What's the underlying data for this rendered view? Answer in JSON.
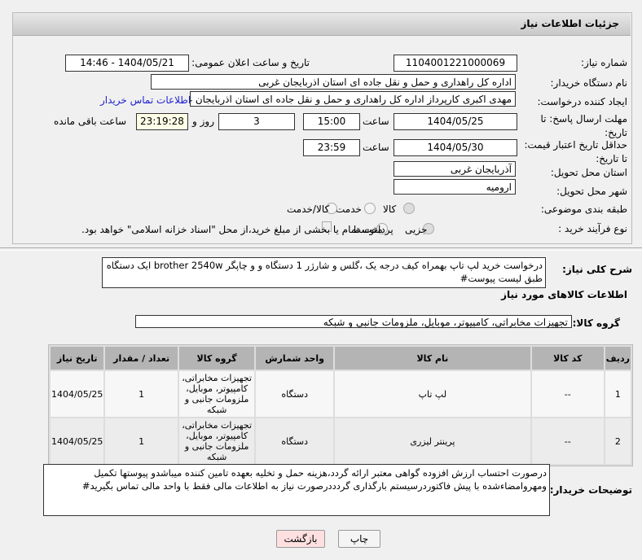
{
  "title": "جزئیات اطلاعات نیاز",
  "fields": {
    "need_number_label": "شماره نیاز:",
    "need_number": "1104001221000069",
    "announce_label": "تاریخ و ساعت اعلان عمومی:",
    "announce_value": "1404/05/21 - 14:46",
    "buyer_org_label": "نام دستگاه خریدار:",
    "buyer_org": "اداره کل راهداری و حمل و نقل جاده ای استان اذربایجان غربی",
    "creator_label": "ایجاد کننده درخواست:",
    "creator": "مهدی اکبری کارپرداز اداره کل راهداری و حمل و نقل جاده ای استان اذربایجان غر",
    "contact_link": "اطلاعات تماس خریدار",
    "deadline_label": "مهلت ارسال پاسخ: تا تاریخ:",
    "deadline_date": "1404/05/25",
    "time_label": "ساعت",
    "deadline_time": "15:00",
    "days": "3",
    "days_label": "روز و",
    "remaining": "23:19:28",
    "remaining_label": "ساعت باقی مانده",
    "validity_label": "حداقل تاریخ اعتبار قیمت: تا تاریخ:",
    "validity_date": "1404/05/30",
    "validity_time": "23:59",
    "province_label": "استان محل تحویل:",
    "province": "آذربایجان غربی",
    "city_label": "شهر محل تحویل:",
    "city": "ارومیه",
    "category_label": "طبقه بندی موضوعی:",
    "cat_options": [
      "کالا",
      "خدمت",
      "کالا/خدمت"
    ],
    "process_label": "نوع فرآیند خرید :",
    "process_options": [
      "جزیی",
      "متوسط"
    ],
    "payment_note": "پرداخت تمام یا بخشی از مبلغ خرید،از محل \"اسناد خزانه اسلامی\" خواهد بود."
  },
  "description_label": "شرح کلی نیاز:",
  "description": "درخواست خرید لپ تاپ  بهمراه کیف درجه یک ،گلس و شارژر 1 دستگاه و و چاپگر brother 2540w ایک دستگاه طبق لیست پیوست#",
  "goods_title": "اطلاعات کالاهای مورد نیاز",
  "group_label": "گروه کالا:",
  "group_value": "تجهیزات مخابراتی، کامپیوتر، موبایل، ملزومات جانبی و شبکه",
  "table": {
    "headers": [
      "ردیف",
      "کد کالا",
      "نام کالا",
      "واحد شمارش",
      "گروه کالا",
      "تعداد / مقدار",
      "تاریخ نیاز"
    ],
    "rows": [
      [
        "1",
        "--",
        "لپ تاپ",
        "دستگاه",
        "تجهیزات مخابراتی، کامپیوتر، موبایل، ملزومات جانبی و شبکه",
        "1",
        "1404/05/25"
      ],
      [
        "2",
        "--",
        "پرینتر لیزری",
        "دستگاه",
        "تجهیزات مخابراتی، کامپیوتر، موبایل، ملزومات جانبی و شبکه",
        "1",
        "1404/05/25"
      ]
    ]
  },
  "notes_label": "توضیحات خریدار:",
  "notes": "درصورت احتساب ارزش افزوده گواهی معتبر ارائه گردد،هزینه حمل و تخلیه بعهده تامین کننده میباشدو پیوستها تکمیل ومهروامضاءشده با پیش فاکتوردرسیستم بارگذاری گردددرصورت نیاز به اطلاعات مالی فقط با واحد مالی تماس بگیرید#",
  "buttons": {
    "print": "چاپ",
    "back": "بازگشت"
  }
}
